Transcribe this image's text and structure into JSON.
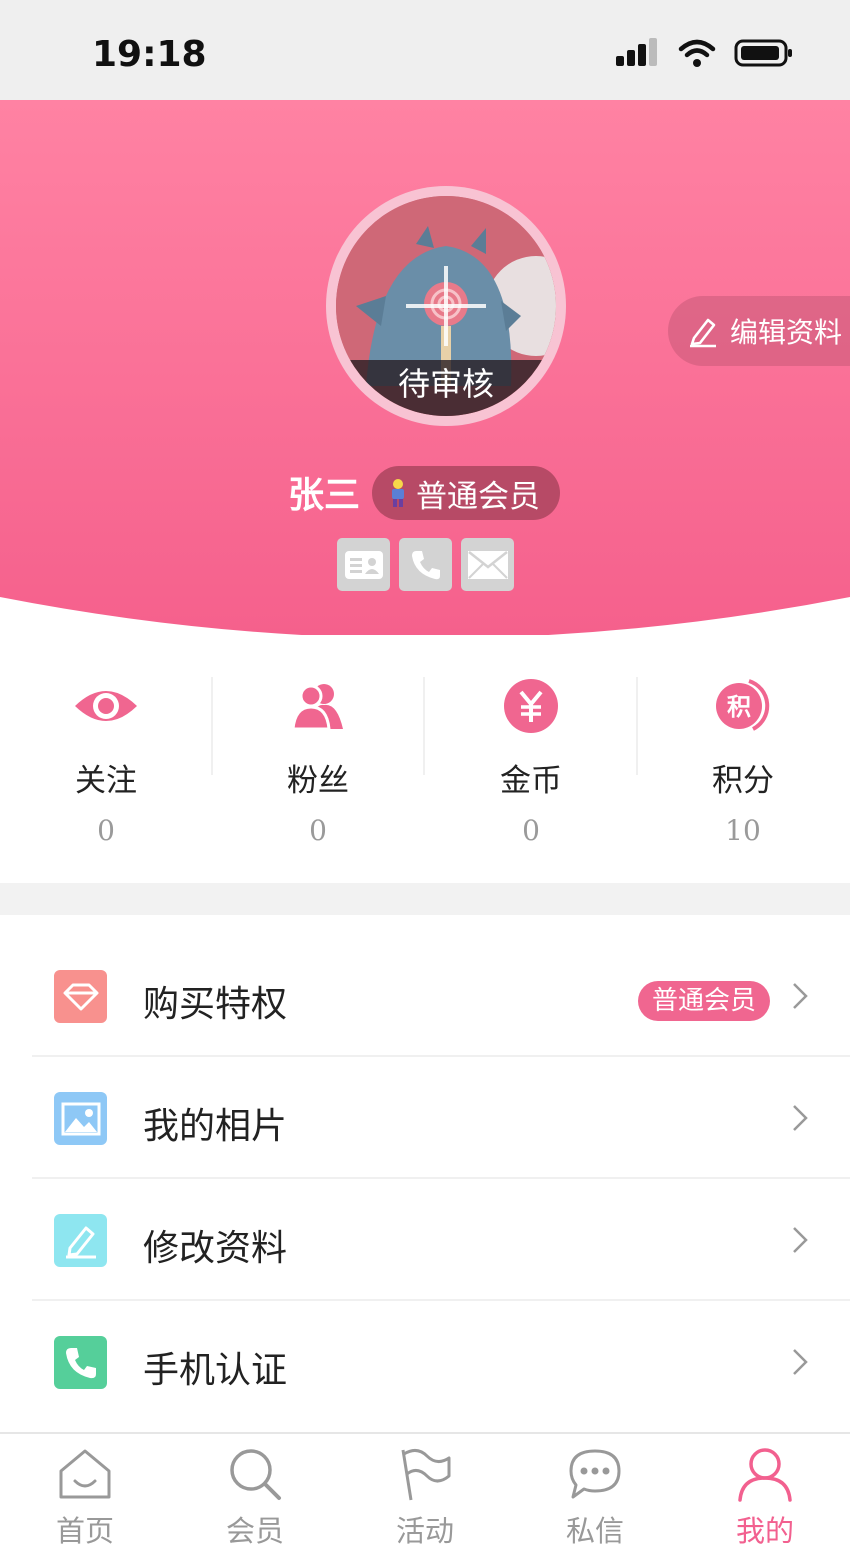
{
  "status_bar": {
    "time": "19:18"
  },
  "colors": {
    "brand": "#f26b94",
    "accent_text": "#f2608f"
  },
  "profile": {
    "name": "张三",
    "avatar_status": "待审核",
    "member_level": "普通会员",
    "edit_label": "编辑资料",
    "verify_icons": [
      "id-card-icon",
      "phone-icon",
      "mail-icon"
    ]
  },
  "stats": [
    {
      "label": "关注",
      "value": "0",
      "icon": "eye-icon"
    },
    {
      "label": "粉丝",
      "value": "0",
      "icon": "users-icon"
    },
    {
      "label": "金币",
      "value": "0",
      "icon": "coin-icon"
    },
    {
      "label": "积分",
      "value": "10",
      "icon": "points-icon"
    }
  ],
  "menu": [
    {
      "label": "购买特权",
      "badge": "普通会员",
      "icon": "diamond-icon"
    },
    {
      "label": "我的相片",
      "icon": "photo-icon"
    },
    {
      "label": "修改资料",
      "icon": "edit-icon"
    },
    {
      "label": "手机认证",
      "icon": "phone-icon"
    }
  ],
  "tabs": [
    {
      "label": "首页",
      "icon": "home-icon",
      "active": false
    },
    {
      "label": "会员",
      "icon": "search-icon",
      "active": false
    },
    {
      "label": "活动",
      "icon": "flag-icon",
      "active": false
    },
    {
      "label": "私信",
      "icon": "chat-icon",
      "active": false
    },
    {
      "label": "我的",
      "icon": "user-icon",
      "active": true
    }
  ]
}
